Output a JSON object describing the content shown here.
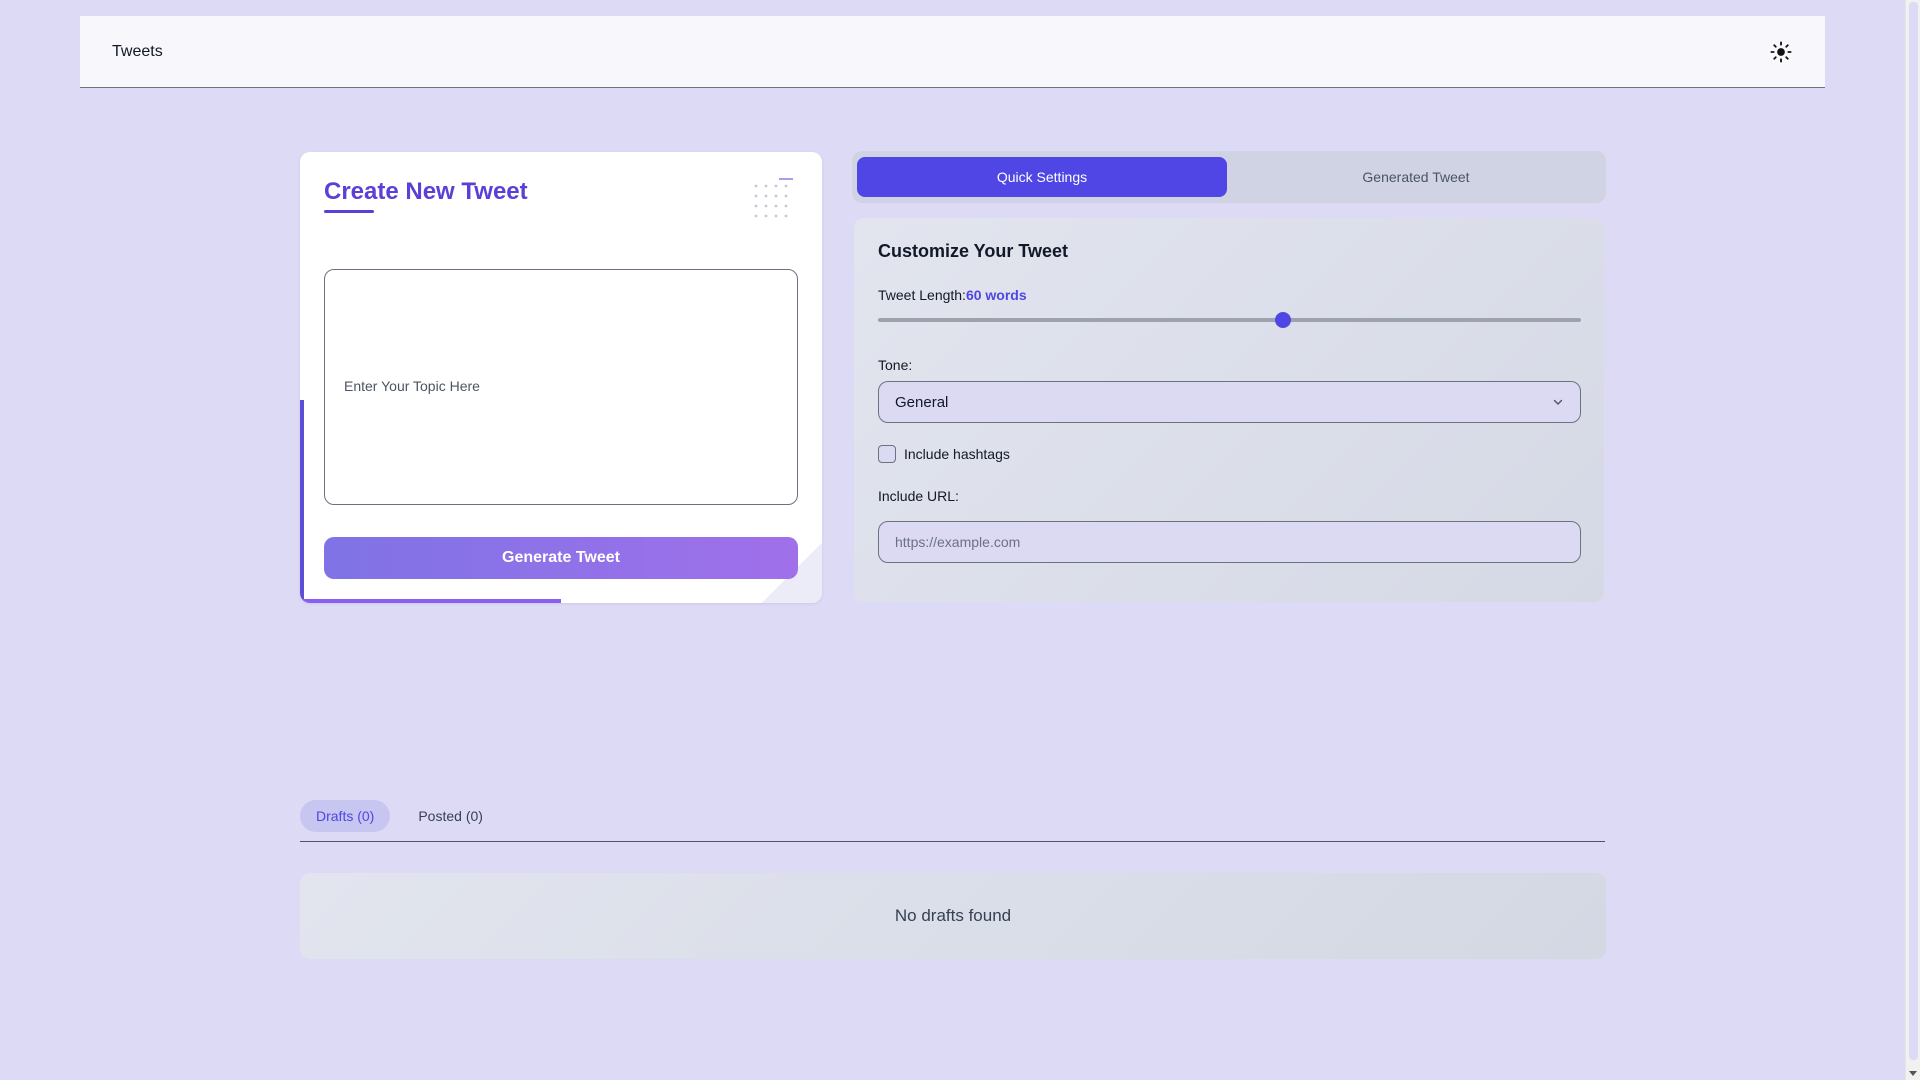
{
  "header": {
    "brand": "Tweets",
    "theme_icon": "sun-icon"
  },
  "create": {
    "title": "Create New Tweet",
    "topic_placeholder": "Enter Your Topic Here",
    "topic_value": "",
    "generate_label": "Generate Tweet"
  },
  "tabs": [
    {
      "label": "Quick Settings",
      "active": true
    },
    {
      "label": "Generated Tweet",
      "active": false
    }
  ],
  "settings": {
    "heading": "Customize Your Tweet",
    "length_label": "Tweet Length:",
    "length_value": "60 words",
    "length_slider_fraction": 0.576,
    "tone_label": "Tone:",
    "tone_value": "General",
    "hashtags_label": "Include hashtags",
    "hashtags_checked": false,
    "url_label": "Include URL:",
    "url_placeholder": "https://example.com",
    "url_value": ""
  },
  "drafts": {
    "tabs": [
      {
        "label": "Drafts (0)",
        "active": true
      },
      {
        "label": "Posted (0)",
        "active": false
      }
    ],
    "empty_message": "No drafts found"
  },
  "colors": {
    "background": "#dcdaf5",
    "accent": "#4f46e5",
    "title": "#5b3fd6"
  }
}
